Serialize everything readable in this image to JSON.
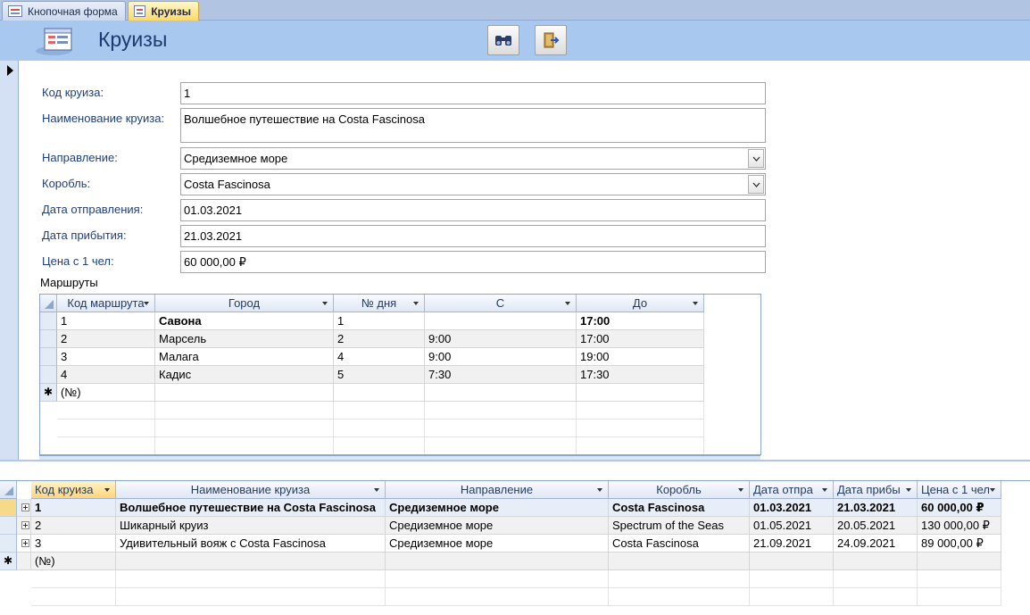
{
  "tabs": [
    {
      "label": "Кнопочная форма",
      "active": false
    },
    {
      "label": "Круизы",
      "active": true
    }
  ],
  "header": {
    "title": "Круизы",
    "find_icon": "binoculars-icon",
    "exit_icon": "exit-door-icon"
  },
  "form": {
    "fields": [
      {
        "label": "Код круиза:",
        "value": "1",
        "type": "text"
      },
      {
        "label": "Наименование круиза:",
        "value": "Волшебное путешествие на Costa Fascinosa",
        "type": "memo"
      },
      {
        "label": "Направление:",
        "value": "Средиземное море",
        "type": "combo"
      },
      {
        "label": "Коробль:",
        "value": "Costa Fascinosa",
        "type": "combo"
      },
      {
        "label": "Дата отправления:",
        "value": "01.03.2021",
        "type": "text"
      },
      {
        "label": "Дата прибытия:",
        "value": "21.03.2021",
        "type": "text"
      },
      {
        "label": "Цена с 1 чел:",
        "value": "60 000,00 ₽",
        "type": "text"
      }
    ]
  },
  "subform": {
    "label": "Маршруты",
    "columns": [
      "Код маршрута",
      "Город",
      "№ дня",
      "С",
      "До"
    ],
    "rows": [
      [
        "1",
        "Савона",
        "1",
        "",
        "17:00"
      ],
      [
        "2",
        "Марсель",
        "2",
        "9:00",
        "17:00"
      ],
      [
        "3",
        "Малага",
        "4",
        "9:00",
        "19:00"
      ],
      [
        "4",
        "Кадис",
        "5",
        "7:30",
        "17:30"
      ]
    ],
    "new_row": "(№)"
  },
  "datasheet": {
    "columns": [
      "Код круиза",
      "Наименование круиза",
      "Направление",
      "Коробль",
      "Дата отпра",
      "Дата прибы",
      "Цена с 1 чел"
    ],
    "rows": [
      [
        "1",
        "Волшебное путешествие на Costa Fascinosa",
        "Средиземное море",
        "Costa Fascinosa",
        "01.03.2021",
        "21.03.2021",
        "60 000,00 ₽"
      ],
      [
        "2",
        "Шикарный круиз",
        "Средиземное море",
        "Spectrum of the Seas",
        "01.05.2021",
        "20.05.2021",
        "130 000,00 ₽"
      ],
      [
        "3",
        "Удивительный вояж с Costa Fascinosa",
        "Средиземное море",
        "Costa Fascinosa",
        "21.09.2021",
        "24.09.2021",
        "89 000,00 ₽"
      ]
    ],
    "new_row": "(№)",
    "new_marker": "✱"
  },
  "colors": {
    "header_bg": "#a9c8ef",
    "title": "#1e3a6e",
    "label": "#1f3f7a",
    "active_tab": "#ffd86a"
  }
}
